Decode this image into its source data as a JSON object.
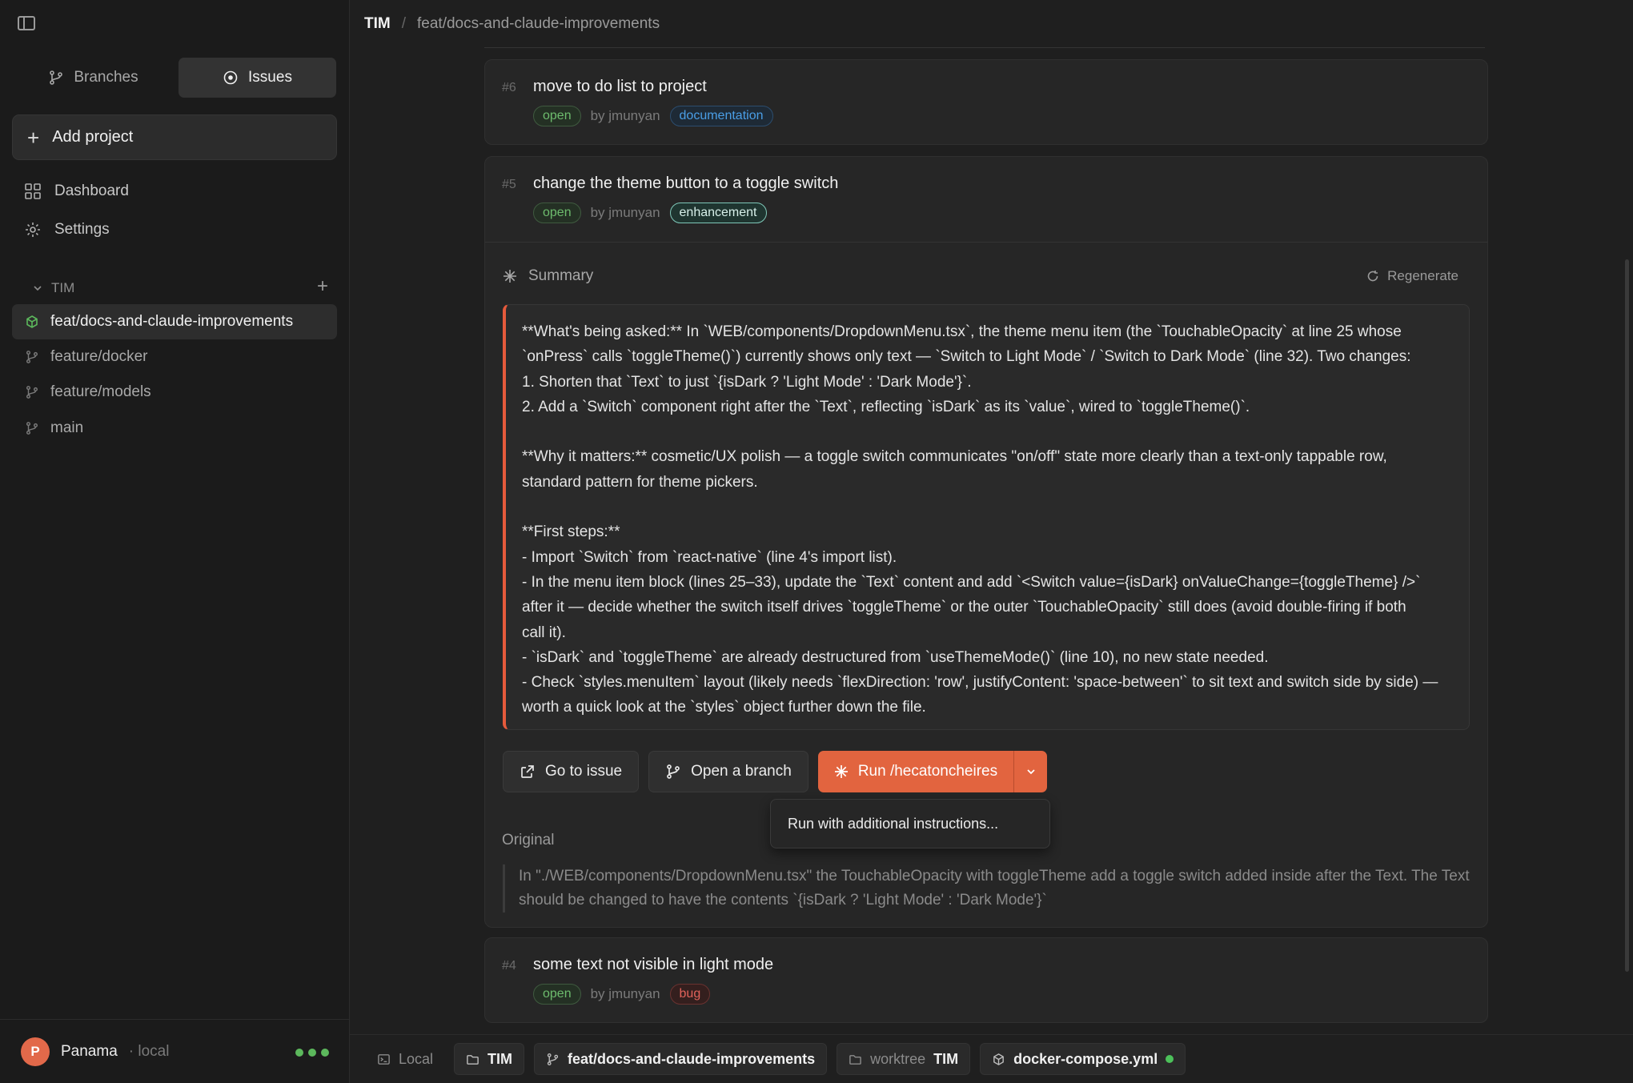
{
  "sidebar": {
    "tabs": [
      {
        "label": "Branches",
        "icon": "git-branch-icon",
        "active": false
      },
      {
        "label": "Issues",
        "icon": "issue-circle-icon",
        "active": true
      }
    ],
    "add_project": "Add project",
    "nav": [
      {
        "label": "Dashboard",
        "icon": "grid-icon"
      },
      {
        "label": "Settings",
        "icon": "gear-icon"
      }
    ],
    "group": {
      "name": "TIM"
    },
    "branches": [
      {
        "name": "feat/docs-and-claude-improvements",
        "active": true
      },
      {
        "name": "feature/docker",
        "active": false
      },
      {
        "name": "feature/models",
        "active": false
      },
      {
        "name": "main",
        "active": false
      }
    ],
    "user": {
      "initial": "P",
      "name": "Panama",
      "location": "· local"
    }
  },
  "header": {
    "root": "TIM",
    "separator": "/",
    "branch": "feat/docs-and-claude-improvements"
  },
  "issues": [
    {
      "number": "#6",
      "title": "move to do list to project",
      "status": "open",
      "author": "by jmunyan",
      "label": "documentation"
    },
    {
      "number": "#5",
      "title": "change the theme button to a toggle switch",
      "status": "open",
      "author": "by jmunyan",
      "label": "enhancement"
    },
    {
      "number": "#4",
      "title": "some text not visible in light mode",
      "status": "open",
      "author": "by jmunyan",
      "label": "bug"
    }
  ],
  "expanded": {
    "summary_label": "Summary",
    "regenerate_label": "Regenerate",
    "summary_text": "**What's being asked:** In `WEB/components/DropdownMenu.tsx`, the theme menu item (the `TouchableOpacity` at line 25 whose\n`onPress` calls `toggleTheme()`) currently shows only text — `Switch to Light Mode` / `Switch to Dark Mode` (line 32). Two changes:\n1. Shorten that `Text` to just `{isDark ? 'Light Mode' : 'Dark Mode'}`.\n2. Add a `Switch` component right after the `Text`, reflecting `isDark` as its `value`, wired to `toggleTheme()`.\n\n**Why it matters:** cosmetic/UX polish — a toggle switch communicates \"on/off\" state more clearly than a text-only tappable row,\nstandard pattern for theme pickers.\n\n**First steps:**\n- Import `Switch` from `react-native` (line 4's import list).\n- In the menu item block (lines 25–33), update the `Text` content and add `<Switch value={isDark} onValueChange={toggleTheme} />`\nafter it — decide whether the switch itself drives `toggleTheme` or the outer `TouchableOpacity` still does (avoid double-firing if both\ncall it).\n- `isDark` and `toggleTheme` are already destructured from `useThemeMode()` (line 10), no new state needed.\n- Check `styles.menuItem` layout (likely needs `flexDirection: 'row', justifyContent: 'space-between'` to sit text and switch side by side) —\nworth a quick look at the `styles` object further down the file.",
    "actions": {
      "go_to_issue": "Go to issue",
      "open_branch": "Open a branch",
      "run": "Run /hecatoncheires"
    },
    "menu_item": "Run with additional instructions...",
    "original_label": "Original",
    "original_text": "In \"./WEB/components/DropdownMenu.tsx\" the TouchableOpacity with toggleTheme add a toggle switch added inside after the Text. The Text should be changed to have the contents `{isDark ? 'Light Mode' : 'Dark Mode'}`"
  },
  "statusbar": {
    "local": "Local",
    "project": "TIM",
    "branch": "feat/docs-and-claude-improvements",
    "worktree_label": "worktree",
    "worktree_name": "TIM",
    "compose": "docker-compose.yml"
  },
  "colors": {
    "accent": "#e2643f",
    "open_green": "#6dbb6d",
    "doc_blue": "#4a9ee6",
    "bug_red": "#e0625a",
    "status_green": "#4cc15a"
  }
}
